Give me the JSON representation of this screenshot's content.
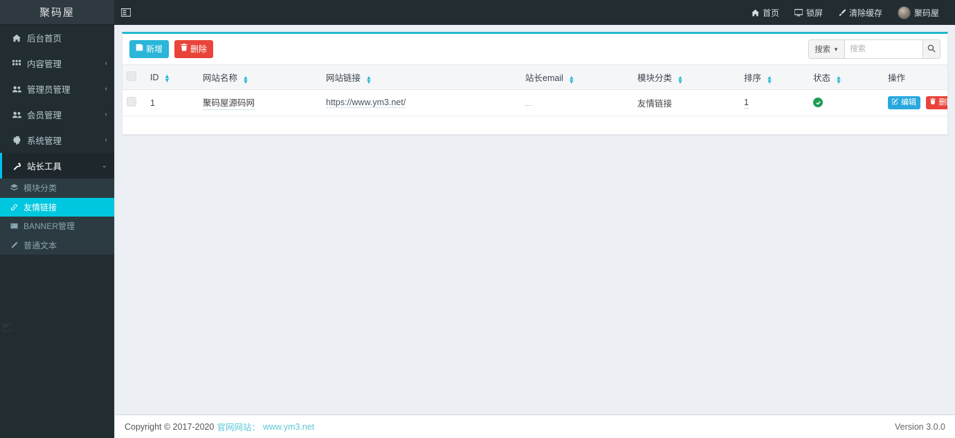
{
  "brand": {
    "title": "聚码屋"
  },
  "navbar": {
    "toggle_icon": "sidebar-toggle-icon",
    "items": [
      {
        "label": "首页",
        "icon": "home-icon"
      },
      {
        "label": "锁屏",
        "icon": "monitor-icon"
      },
      {
        "label": "清除缓存",
        "icon": "brush-icon"
      }
    ],
    "user": {
      "name": "聚码屋",
      "avatar": "user-avatar"
    }
  },
  "sidebar": {
    "items": [
      {
        "label": "后台首页",
        "icon": "home-icon",
        "caret": ""
      },
      {
        "label": "内容管理",
        "icon": "grid-icon",
        "caret": "‹"
      },
      {
        "label": "管理员管理",
        "icon": "users-icon",
        "caret": "‹"
      },
      {
        "label": "会员管理",
        "icon": "users-icon",
        "caret": "‹"
      },
      {
        "label": "系统管理",
        "icon": "gear-icon",
        "caret": "‹"
      },
      {
        "label": "站长工具",
        "icon": "wrench-icon",
        "caret": "⌄"
      }
    ],
    "submenu": [
      {
        "label": "模块分类",
        "icon": "layers-icon"
      },
      {
        "label": "友情链接",
        "icon": "link-icon"
      },
      {
        "label": "BANNER管理",
        "icon": "image-icon"
      },
      {
        "label": "普通文本",
        "icon": "pencil-icon"
      }
    ]
  },
  "toolbar": {
    "add_label": "新增",
    "add_icon": "save-icon",
    "delete_label": "删除",
    "delete_icon": "trash-icon",
    "search_dropdown_label": "搜索",
    "search_placeholder": "搜索",
    "search_value": "",
    "search_icon": "search-icon"
  },
  "table": {
    "columns": [
      {
        "key": "checkbox",
        "label": "",
        "sortable": false
      },
      {
        "key": "id",
        "label": "ID",
        "sortable": true
      },
      {
        "key": "name",
        "label": "网站名称",
        "sortable": true
      },
      {
        "key": "link",
        "label": "网站链接",
        "sortable": true
      },
      {
        "key": "email",
        "label": "站长email",
        "sortable": true
      },
      {
        "key": "category",
        "label": "模块分类",
        "sortable": true
      },
      {
        "key": "sort",
        "label": "排序",
        "sortable": true
      },
      {
        "key": "status",
        "label": "状态",
        "sortable": true
      },
      {
        "key": "ops",
        "label": "操作",
        "sortable": false
      }
    ],
    "rows": [
      {
        "id": "1",
        "name": "聚码屋源码网",
        "link": "https://www.ym3.net/",
        "email": "",
        "category": "友情链接",
        "sort": "1",
        "status": "enabled",
        "status_icon": "check-circle-icon",
        "edit_label": "编辑",
        "edit_icon": "edit-icon",
        "delete_label": "删除",
        "delete_icon": "trash-icon"
      }
    ]
  },
  "footer": {
    "copyright": "Copyright © 2017-2020",
    "site_label": "官网网站：",
    "site_url": "www.ym3.net",
    "version": "Version 3.0.0"
  },
  "colors": {
    "accent": "#00c0ef",
    "panel_top": "#22b8cf",
    "sidebar_bg": "#222d32",
    "submenu_bg": "#2c3b41",
    "active_submenu": "#00c7e0",
    "danger": "#e8443a",
    "success": "#1f9d55",
    "content_bg": "#ecf0f5"
  }
}
